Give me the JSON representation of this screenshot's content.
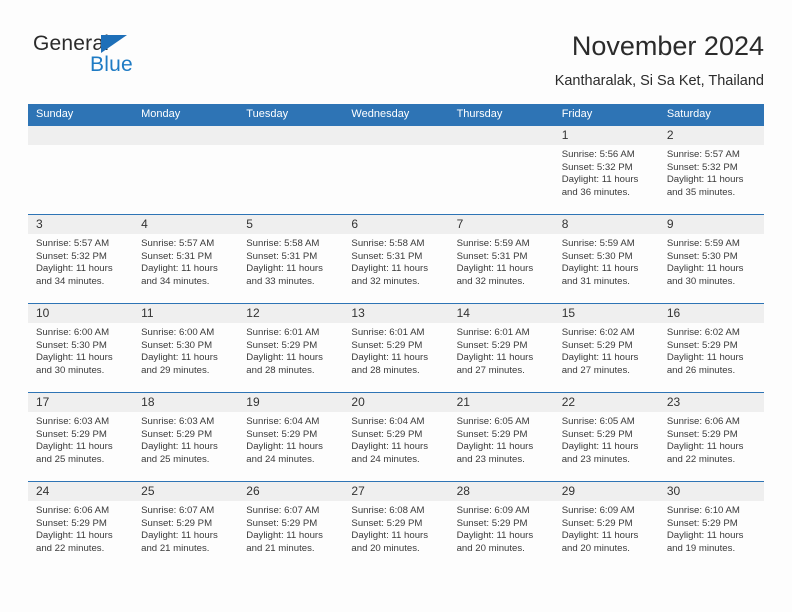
{
  "brand": {
    "name_part1": "General",
    "name_part2": "Blue",
    "triangle_color": "#1e6fb8",
    "blue_color": "#1e7bc4"
  },
  "header": {
    "title": "November 2024",
    "subtitle": "Kantharalak, Si Sa Ket, Thailand"
  },
  "theme": {
    "header_bg": "#2e74b5",
    "header_text": "#ffffff",
    "daynum_bg": "#efefef",
    "row_divider": "#2e74b5",
    "page_bg": "#fdfdfd"
  },
  "weekdays": [
    {
      "label": "Sunday"
    },
    {
      "label": "Monday"
    },
    {
      "label": "Tuesday"
    },
    {
      "label": "Wednesday"
    },
    {
      "label": "Thursday"
    },
    {
      "label": "Friday"
    },
    {
      "label": "Saturday"
    }
  ],
  "weeks": [
    {
      "days": [
        {
          "date": "",
          "line1": "",
          "line2": "",
          "line3": "",
          "line4": ""
        },
        {
          "date": "",
          "line1": "",
          "line2": "",
          "line3": "",
          "line4": ""
        },
        {
          "date": "",
          "line1": "",
          "line2": "",
          "line3": "",
          "line4": ""
        },
        {
          "date": "",
          "line1": "",
          "line2": "",
          "line3": "",
          "line4": ""
        },
        {
          "date": "",
          "line1": "",
          "line2": "",
          "line3": "",
          "line4": ""
        },
        {
          "date": "1",
          "line1": "Sunrise: 5:56 AM",
          "line2": "Sunset: 5:32 PM",
          "line3": "Daylight: 11 hours",
          "line4": "and 36 minutes."
        },
        {
          "date": "2",
          "line1": "Sunrise: 5:57 AM",
          "line2": "Sunset: 5:32 PM",
          "line3": "Daylight: 11 hours",
          "line4": "and 35 minutes."
        }
      ]
    },
    {
      "days": [
        {
          "date": "3",
          "line1": "Sunrise: 5:57 AM",
          "line2": "Sunset: 5:32 PM",
          "line3": "Daylight: 11 hours",
          "line4": "and 34 minutes."
        },
        {
          "date": "4",
          "line1": "Sunrise: 5:57 AM",
          "line2": "Sunset: 5:31 PM",
          "line3": "Daylight: 11 hours",
          "line4": "and 34 minutes."
        },
        {
          "date": "5",
          "line1": "Sunrise: 5:58 AM",
          "line2": "Sunset: 5:31 PM",
          "line3": "Daylight: 11 hours",
          "line4": "and 33 minutes."
        },
        {
          "date": "6",
          "line1": "Sunrise: 5:58 AM",
          "line2": "Sunset: 5:31 PM",
          "line3": "Daylight: 11 hours",
          "line4": "and 32 minutes."
        },
        {
          "date": "7",
          "line1": "Sunrise: 5:59 AM",
          "line2": "Sunset: 5:31 PM",
          "line3": "Daylight: 11 hours",
          "line4": "and 32 minutes."
        },
        {
          "date": "8",
          "line1": "Sunrise: 5:59 AM",
          "line2": "Sunset: 5:30 PM",
          "line3": "Daylight: 11 hours",
          "line4": "and 31 minutes."
        },
        {
          "date": "9",
          "line1": "Sunrise: 5:59 AM",
          "line2": "Sunset: 5:30 PM",
          "line3": "Daylight: 11 hours",
          "line4": "and 30 minutes."
        }
      ]
    },
    {
      "days": [
        {
          "date": "10",
          "line1": "Sunrise: 6:00 AM",
          "line2": "Sunset: 5:30 PM",
          "line3": "Daylight: 11 hours",
          "line4": "and 30 minutes."
        },
        {
          "date": "11",
          "line1": "Sunrise: 6:00 AM",
          "line2": "Sunset: 5:30 PM",
          "line3": "Daylight: 11 hours",
          "line4": "and 29 minutes."
        },
        {
          "date": "12",
          "line1": "Sunrise: 6:01 AM",
          "line2": "Sunset: 5:29 PM",
          "line3": "Daylight: 11 hours",
          "line4": "and 28 minutes."
        },
        {
          "date": "13",
          "line1": "Sunrise: 6:01 AM",
          "line2": "Sunset: 5:29 PM",
          "line3": "Daylight: 11 hours",
          "line4": "and 28 minutes."
        },
        {
          "date": "14",
          "line1": "Sunrise: 6:01 AM",
          "line2": "Sunset: 5:29 PM",
          "line3": "Daylight: 11 hours",
          "line4": "and 27 minutes."
        },
        {
          "date": "15",
          "line1": "Sunrise: 6:02 AM",
          "line2": "Sunset: 5:29 PM",
          "line3": "Daylight: 11 hours",
          "line4": "and 27 minutes."
        },
        {
          "date": "16",
          "line1": "Sunrise: 6:02 AM",
          "line2": "Sunset: 5:29 PM",
          "line3": "Daylight: 11 hours",
          "line4": "and 26 minutes."
        }
      ]
    },
    {
      "days": [
        {
          "date": "17",
          "line1": "Sunrise: 6:03 AM",
          "line2": "Sunset: 5:29 PM",
          "line3": "Daylight: 11 hours",
          "line4": "and 25 minutes."
        },
        {
          "date": "18",
          "line1": "Sunrise: 6:03 AM",
          "line2": "Sunset: 5:29 PM",
          "line3": "Daylight: 11 hours",
          "line4": "and 25 minutes."
        },
        {
          "date": "19",
          "line1": "Sunrise: 6:04 AM",
          "line2": "Sunset: 5:29 PM",
          "line3": "Daylight: 11 hours",
          "line4": "and 24 minutes."
        },
        {
          "date": "20",
          "line1": "Sunrise: 6:04 AM",
          "line2": "Sunset: 5:29 PM",
          "line3": "Daylight: 11 hours",
          "line4": "and 24 minutes."
        },
        {
          "date": "21",
          "line1": "Sunrise: 6:05 AM",
          "line2": "Sunset: 5:29 PM",
          "line3": "Daylight: 11 hours",
          "line4": "and 23 minutes."
        },
        {
          "date": "22",
          "line1": "Sunrise: 6:05 AM",
          "line2": "Sunset: 5:29 PM",
          "line3": "Daylight: 11 hours",
          "line4": "and 23 minutes."
        },
        {
          "date": "23",
          "line1": "Sunrise: 6:06 AM",
          "line2": "Sunset: 5:29 PM",
          "line3": "Daylight: 11 hours",
          "line4": "and 22 minutes."
        }
      ]
    },
    {
      "days": [
        {
          "date": "24",
          "line1": "Sunrise: 6:06 AM",
          "line2": "Sunset: 5:29 PM",
          "line3": "Daylight: 11 hours",
          "line4": "and 22 minutes."
        },
        {
          "date": "25",
          "line1": "Sunrise: 6:07 AM",
          "line2": "Sunset: 5:29 PM",
          "line3": "Daylight: 11 hours",
          "line4": "and 21 minutes."
        },
        {
          "date": "26",
          "line1": "Sunrise: 6:07 AM",
          "line2": "Sunset: 5:29 PM",
          "line3": "Daylight: 11 hours",
          "line4": "and 21 minutes."
        },
        {
          "date": "27",
          "line1": "Sunrise: 6:08 AM",
          "line2": "Sunset: 5:29 PM",
          "line3": "Daylight: 11 hours",
          "line4": "and 20 minutes."
        },
        {
          "date": "28",
          "line1": "Sunrise: 6:09 AM",
          "line2": "Sunset: 5:29 PM",
          "line3": "Daylight: 11 hours",
          "line4": "and 20 minutes."
        },
        {
          "date": "29",
          "line1": "Sunrise: 6:09 AM",
          "line2": "Sunset: 5:29 PM",
          "line3": "Daylight: 11 hours",
          "line4": "and 20 minutes."
        },
        {
          "date": "30",
          "line1": "Sunrise: 6:10 AM",
          "line2": "Sunset: 5:29 PM",
          "line3": "Daylight: 11 hours",
          "line4": "and 19 minutes."
        }
      ]
    }
  ]
}
